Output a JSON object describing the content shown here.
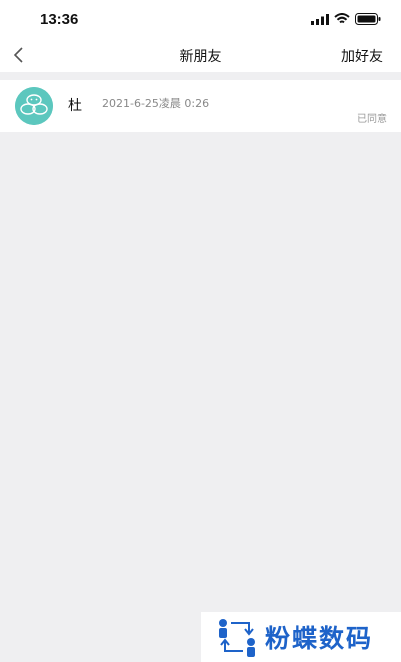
{
  "status_bar": {
    "time": "13:36",
    "icons": [
      "signal-icon",
      "wifi-icon",
      "battery-icon"
    ]
  },
  "nav": {
    "back_icon": "chevron-left-icon",
    "title": "新朋友",
    "right_action": "加好友"
  },
  "friend_requests": [
    {
      "name": "杜",
      "time": "2021-6-25凌晨 0:26",
      "status": "已同意",
      "avatar_color": "#5cc7be"
    }
  ],
  "watermark": {
    "text": "粉蝶数码",
    "color": "#1e63c9"
  },
  "colors": {
    "background": "#efeff1",
    "surface": "#ffffff"
  }
}
